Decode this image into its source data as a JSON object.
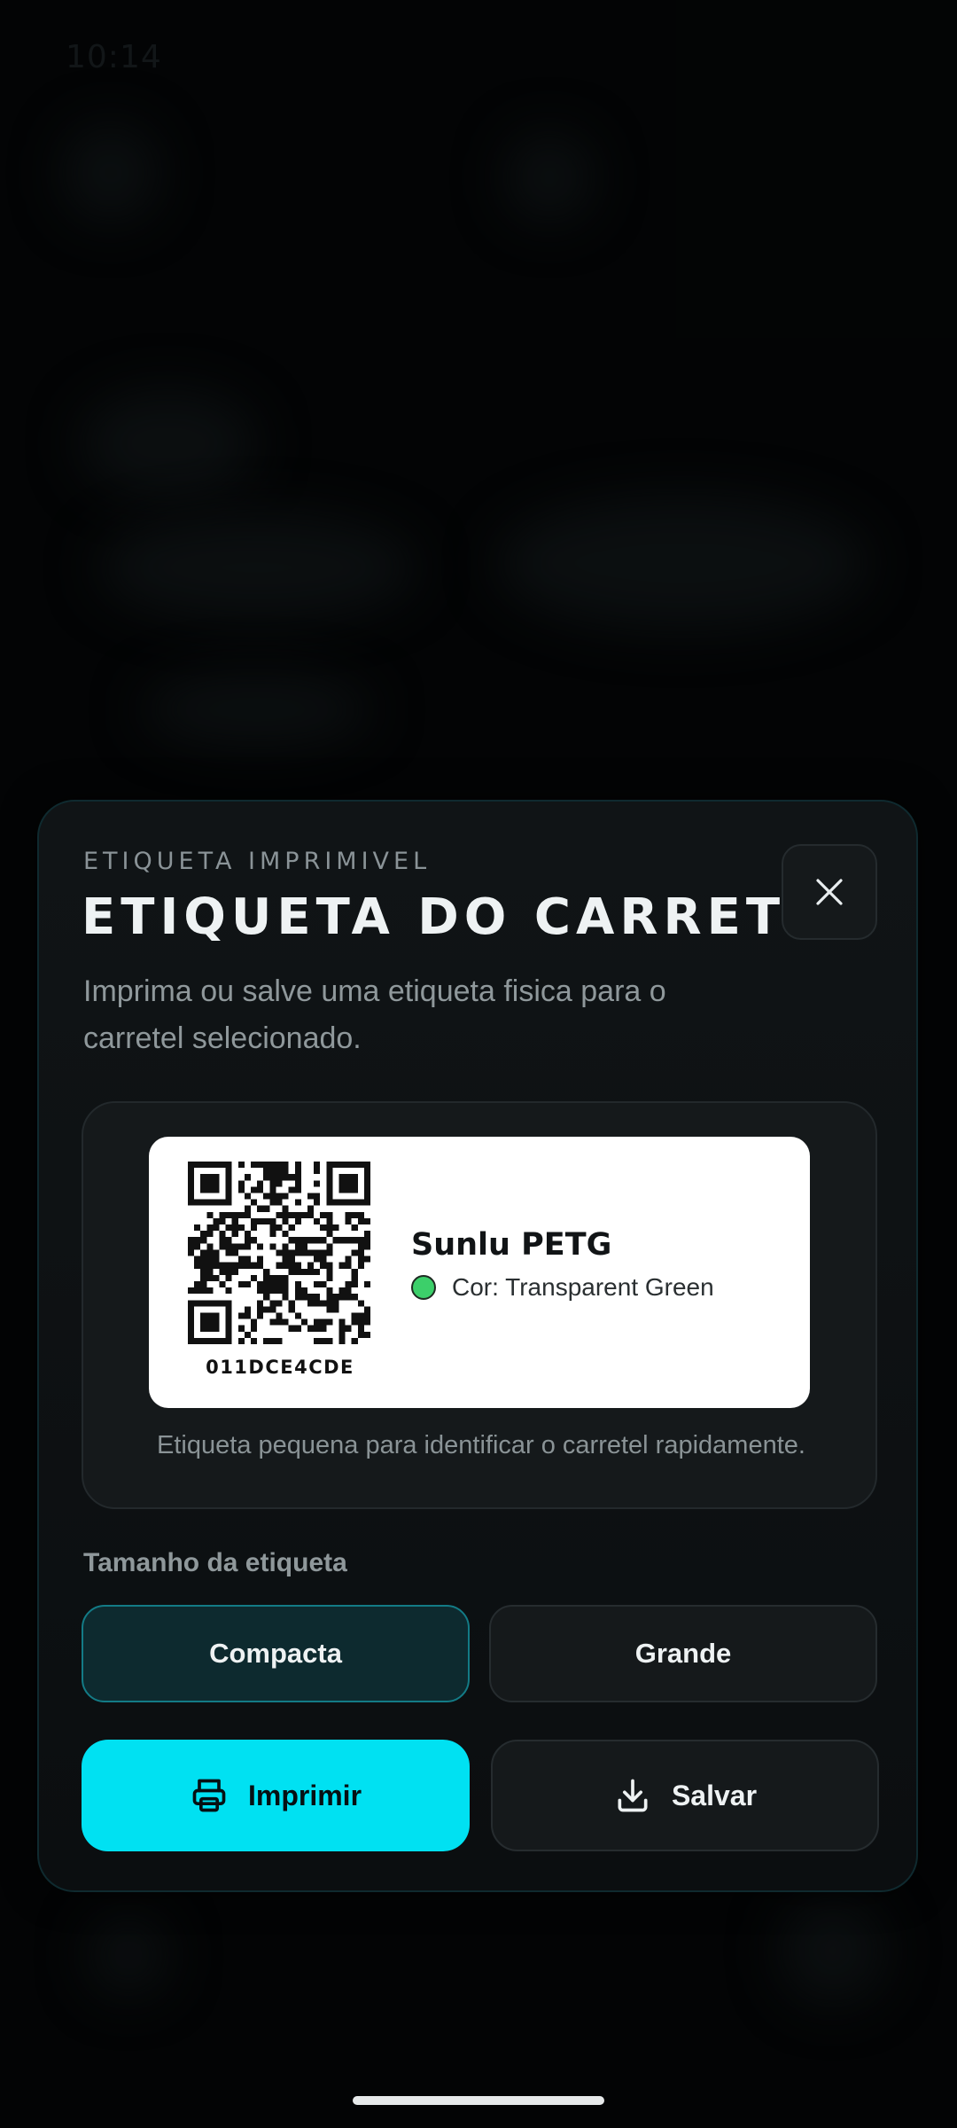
{
  "status_bar": {
    "time": "10:14"
  },
  "sheet": {
    "eyebrow": "ETIQUETA IMPRIMIVEL",
    "title": "ETIQUETA DO CARRETEL",
    "subtitle": "Imprima ou salve uma etiqueta fisica para o carretel selecionado.",
    "close_icon": "close-icon"
  },
  "preview": {
    "qr_code_text": "011DCE4CDE",
    "material_name": "Sunlu PETG",
    "color_text": "Cor: Transparent Green",
    "color_swatch": "#3ccf6a",
    "caption": "Etiqueta pequena para identificar o carretel rapidamente."
  },
  "size": {
    "label": "Tamanho da etiqueta",
    "options": [
      "Compacta",
      "Grande"
    ],
    "selected": "Compacta"
  },
  "actions": {
    "print_label": "Imprimir",
    "print_icon": "printer-icon",
    "save_label": "Salvar",
    "save_icon": "download-icon"
  },
  "colors": {
    "accent": "#00e1f2",
    "selected_border": "#137b86",
    "background": "#050708"
  }
}
